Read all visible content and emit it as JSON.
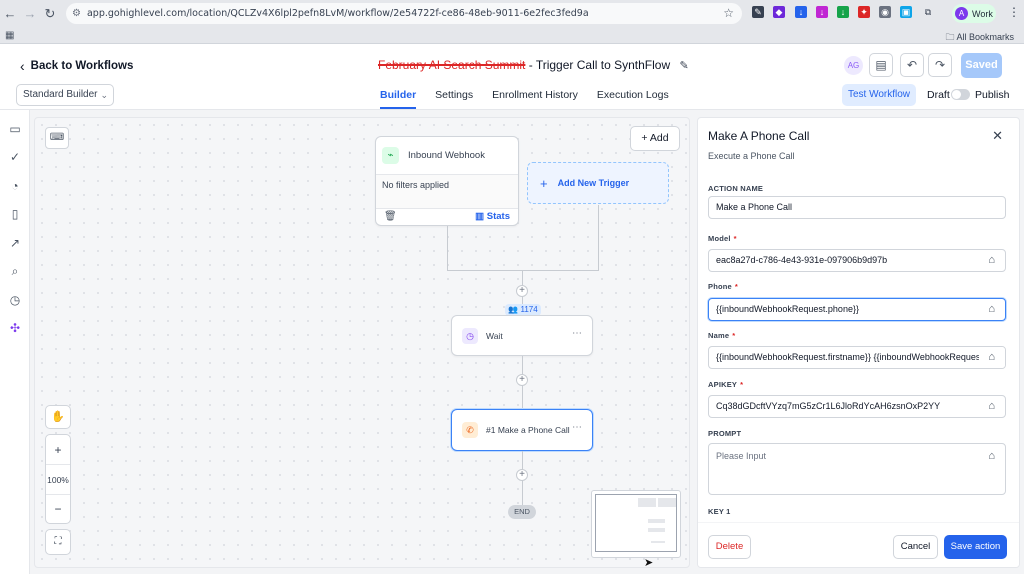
{
  "browser": {
    "url": "app.gohighlevel.com/location/QCLZv4X6lpl2pefn8LvM/workflow/2e54722f-ce86-48eb-9011-6e2fec3fed9a",
    "profile_initial": "A",
    "profile_label": "Work",
    "bookmarks_label": "All Bookmarks"
  },
  "header": {
    "back_label": "Back to Workflows",
    "title_struck": "February AI Search Summit",
    "title_rest": " - Trigger Call to SynthFlow",
    "user_initials": "AG",
    "saved_label": "Saved",
    "builder_select": "Standard Builder",
    "tabs": [
      {
        "label": "Builder",
        "active": true
      },
      {
        "label": "Settings",
        "active": false
      },
      {
        "label": "Enrollment History",
        "active": false
      },
      {
        "label": "Execution Logs",
        "active": false
      }
    ],
    "test_workflow_label": "Test Workflow",
    "draft_label": "Draft",
    "publish_label": "Publish"
  },
  "canvas": {
    "add_label": "Add",
    "trigger": {
      "title": "Inbound Webhook",
      "filters": "No filters applied",
      "stats_label": "Stats"
    },
    "new_trigger_label": "Add New Trigger",
    "enrolled_count": "1174",
    "steps": [
      {
        "label": "Wait"
      },
      {
        "label": "#1 Make a Phone Call"
      }
    ],
    "end_label": "END",
    "zoom_level": "100%"
  },
  "panel": {
    "title": "Make A Phone Call",
    "subtitle": "Execute a Phone Call",
    "action_name_label": "ACTION NAME",
    "action_name_value": "Make a Phone Call",
    "model_label": "Model",
    "model_value": "eac8a27d-c786-4e43-931e-097906b9d97b",
    "phone_label": "Phone",
    "phone_value": "{{inboundWebhookRequest.phone}}",
    "name_label": "Name",
    "name_value": "{{inboundWebhookRequest.firstname}} {{inboundWebhookRequest.lastname}}",
    "apikey_label": "APIKEY",
    "apikey_value": "Cq38dGDcftVYzq7mG5zCr1L6JloRdYcAH6zsnOxP2YY",
    "prompt_label": "PROMPT",
    "prompt_placeholder": "Please Input",
    "key1_label": "KEY 1",
    "delete_label": "Delete",
    "cancel_label": "Cancel",
    "save_label": "Save action"
  }
}
